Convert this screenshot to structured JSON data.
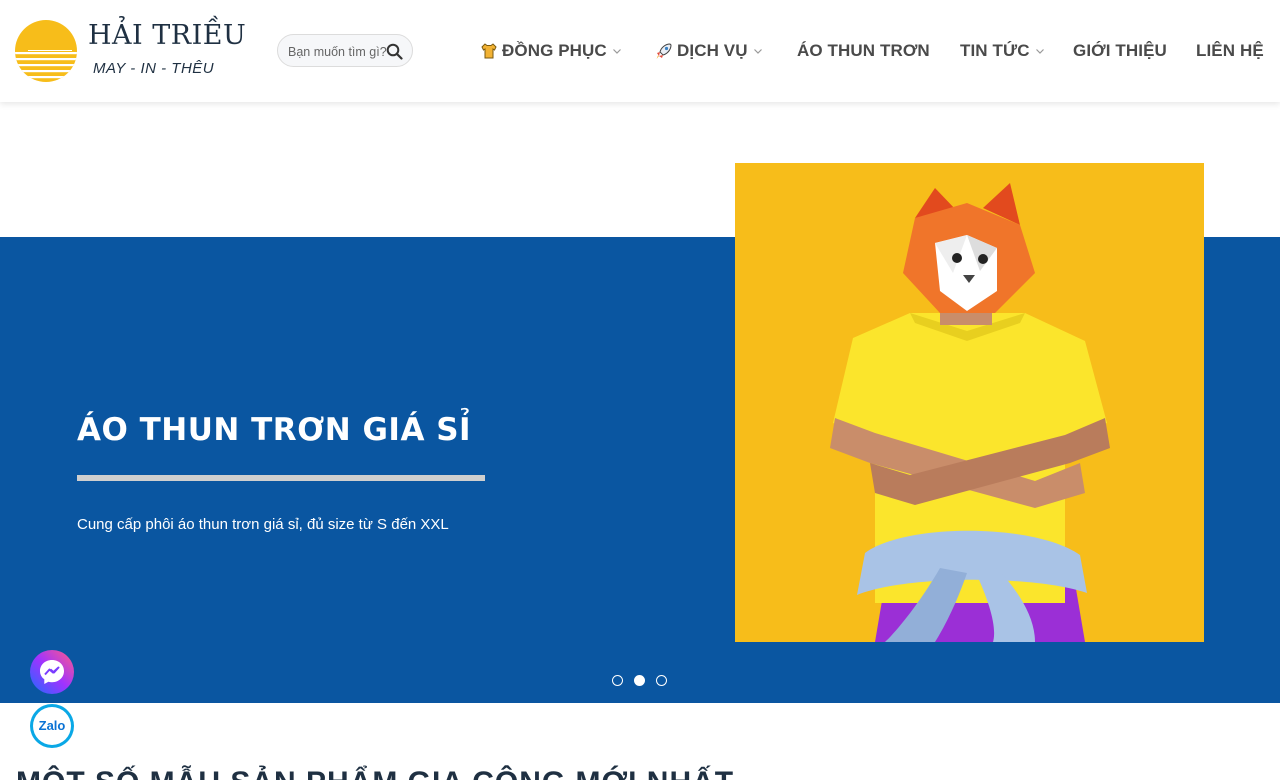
{
  "brand": {
    "name": "HẢI TRIỀU",
    "tagline": "MAY - IN - THÊU"
  },
  "search": {
    "placeholder": "Bạn muốn tìm gì?"
  },
  "nav": {
    "items": [
      {
        "label": "ĐỒNG PHỤC",
        "icon": "shirt-emoji-icon",
        "dropdown": true
      },
      {
        "label": "DỊCH VỤ",
        "icon": "rocket-emoji-icon",
        "dropdown": true
      },
      {
        "label": "ÁO THUN TRƠN",
        "dropdown": false
      },
      {
        "label": "TIN TỨC",
        "dropdown": true
      },
      {
        "label": "GIỚI THIỆU",
        "dropdown": false
      },
      {
        "label": "LIÊN HỆ",
        "dropdown": false
      }
    ]
  },
  "hero": {
    "title": "ÁO THUN TRƠN GIÁ SỈ",
    "subtitle": "Cung cấp phôi áo thun trơn giá sỉ, đủ size từ S đến XXL",
    "slide_count": 3,
    "active_slide": 2
  },
  "section": {
    "title": "MỘT SỐ MẪU SẢN PHẨM GIA CÔNG MỚI NHẤT"
  },
  "floating": {
    "zalo_label": "Zalo"
  },
  "colors": {
    "brand_blue": "#0a56a1",
    "brand_yellow": "#f7bd1a",
    "text_dark": "#1f3042",
    "nav_text": "#4a4a4a"
  }
}
